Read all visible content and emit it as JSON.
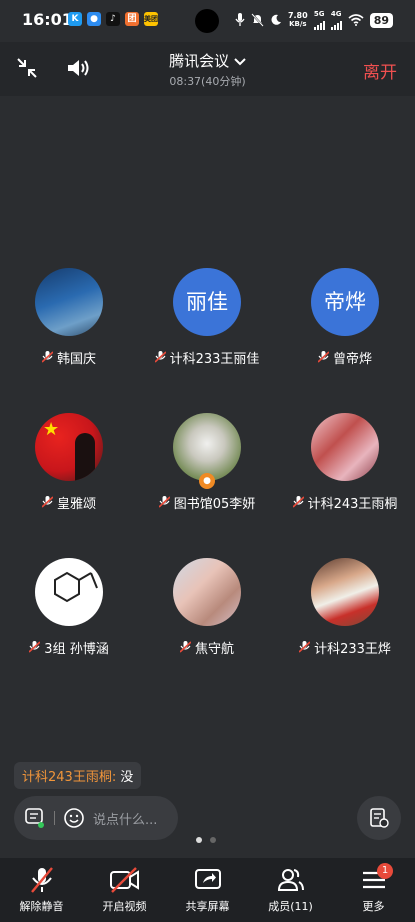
{
  "status_bar": {
    "time": "16:01",
    "app_icons": [
      {
        "icon": "k-app-icon",
        "label": "K",
        "color": "#1f9bf0"
      },
      {
        "icon": "chat-app-icon",
        "label": "●",
        "color": "#2d8cf0"
      },
      {
        "icon": "tiktok-icon",
        "label": "♪",
        "color": "#111111"
      },
      {
        "icon": "shop-app-icon",
        "label": "团",
        "color": "#f07030"
      },
      {
        "icon": "meituan-icon",
        "label": "美团",
        "color": "#ffc300"
      }
    ],
    "speed_value": "7.80",
    "speed_unit": "KB/s",
    "net_5g": "5G",
    "net_4g": "4G",
    "battery": "89"
  },
  "header": {
    "title": "腾讯会议",
    "subtitle": "08:37(40分钟)",
    "leave_label": "离开"
  },
  "participants": [
    {
      "name": "韩国庆",
      "avatar_text": "",
      "avatar_bg": "linear-gradient(160deg,#163c6e 0%,#2a6ab0 45%,#6e9fc8 75%,#2b4a6a 100%)"
    },
    {
      "name": "计科233王丽佳",
      "avatar_text": "丽佳",
      "avatar_bg": "#3b74d8"
    },
    {
      "name": "曾帝烨",
      "avatar_text": "帝烨",
      "avatar_bg": "#3b74d8"
    },
    {
      "name": "皇雅颂",
      "avatar_text": "",
      "avatar_bg": "radial-gradient(circle at 35% 35%,#e8231f 0%,#c8161b 55%,#3a1a1a 100%)",
      "flag": "★"
    },
    {
      "name": "图书馆05李妍",
      "avatar_text": "",
      "avatar_bg": "radial-gradient(circle at 50% 45%,#f0f0ee 0%,#c9c8be 35%,#7a8f5c 70%,#4d6338 100%)",
      "badge": true
    },
    {
      "name": "计科243王雨桐",
      "avatar_text": "",
      "avatar_bg": "linear-gradient(135deg,#f2c9cf 0%,#c0504e 40%,#e8b4bd 70%,#8a3a45 100%)"
    },
    {
      "name": "3组 孙博涵",
      "avatar_text": "",
      "avatar_bg": "#ffffff",
      "structure": true
    },
    {
      "name": "焦守航",
      "avatar_text": "",
      "avatar_bg": "linear-gradient(135deg,#cfd8e4 0%,#e8c3b8 40%,#b88a7c 70%,#d7c0c8 100%)"
    },
    {
      "name": "计科233王烨",
      "avatar_text": "",
      "avatar_bg": "linear-gradient(160deg,#5a3a2e 0%,#d8a88a 35%,#f0efe8 55%,#c8302a 75%,#7a4a38 100%)"
    }
  ],
  "chat": {
    "sender": "计科243王雨桐:",
    "message": " 没",
    "placeholder": "说点什么..."
  },
  "toolbar": [
    {
      "label": "解除静音",
      "icon": "mic-muted-icon"
    },
    {
      "label": "开启视频",
      "icon": "video-off-icon"
    },
    {
      "label": "共享屏幕",
      "icon": "share-screen-icon"
    },
    {
      "label": "成员(11)",
      "icon": "members-icon"
    },
    {
      "label": "更多",
      "icon": "more-icon",
      "badge": "1"
    }
  ]
}
